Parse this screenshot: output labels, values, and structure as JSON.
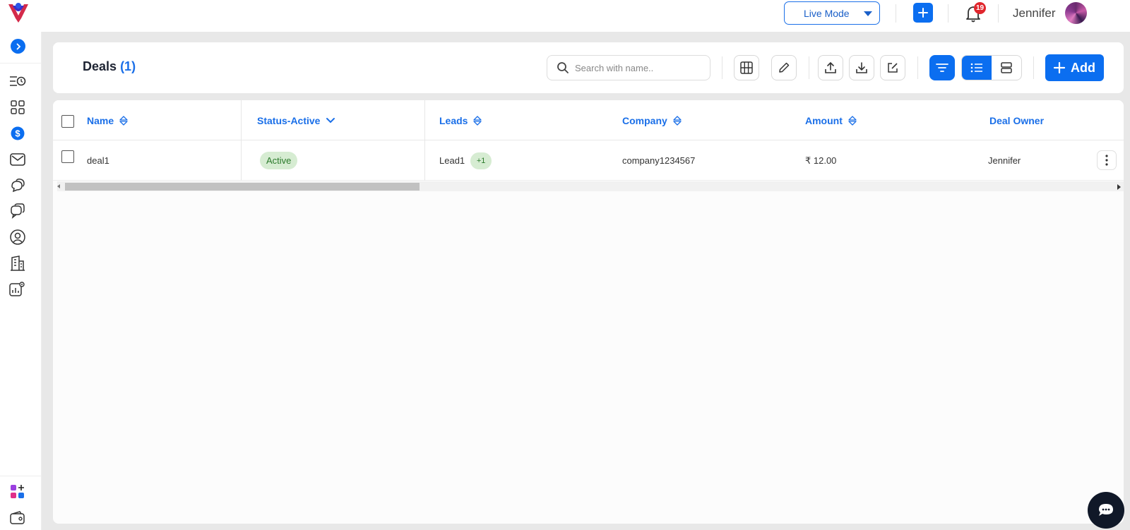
{
  "topbar": {
    "mode_label": "Live Mode",
    "notification_count": "19",
    "username": "Jennifer"
  },
  "sidebar": {
    "items": [
      {
        "icon": "activity-list-icon"
      },
      {
        "icon": "dashboard-grid-icon"
      },
      {
        "icon": "deals-dollar-icon",
        "active": true
      },
      {
        "icon": "mail-icon"
      },
      {
        "icon": "conversations-icon"
      },
      {
        "icon": "chat-icon"
      },
      {
        "icon": "contacts-icon"
      },
      {
        "icon": "company-building-icon"
      },
      {
        "icon": "reports-settings-icon"
      }
    ],
    "bottom": [
      {
        "icon": "apps-add-icon"
      },
      {
        "icon": "wallet-icon"
      }
    ]
  },
  "header": {
    "title": "Deals",
    "count": "(1)",
    "search_placeholder": "Search with name..",
    "add_label": "Add"
  },
  "table": {
    "columns": {
      "name": "Name",
      "status": "Status-Active",
      "leads": "Leads",
      "company": "Company",
      "amount": "Amount",
      "owner": "Deal Owner"
    },
    "rows": [
      {
        "name": "deal1",
        "status": "Active",
        "lead": "Lead1",
        "lead_extra": "+1",
        "company": "company1234567",
        "amount": "₹ 12.00",
        "owner": "Jennifer"
      }
    ]
  },
  "colors": {
    "accent": "#0b6ef0",
    "header_text": "#1a6fe8",
    "badge_bg": "#d6ecd2",
    "badge_text": "#2b7a2b",
    "notification": "#e0262d"
  }
}
